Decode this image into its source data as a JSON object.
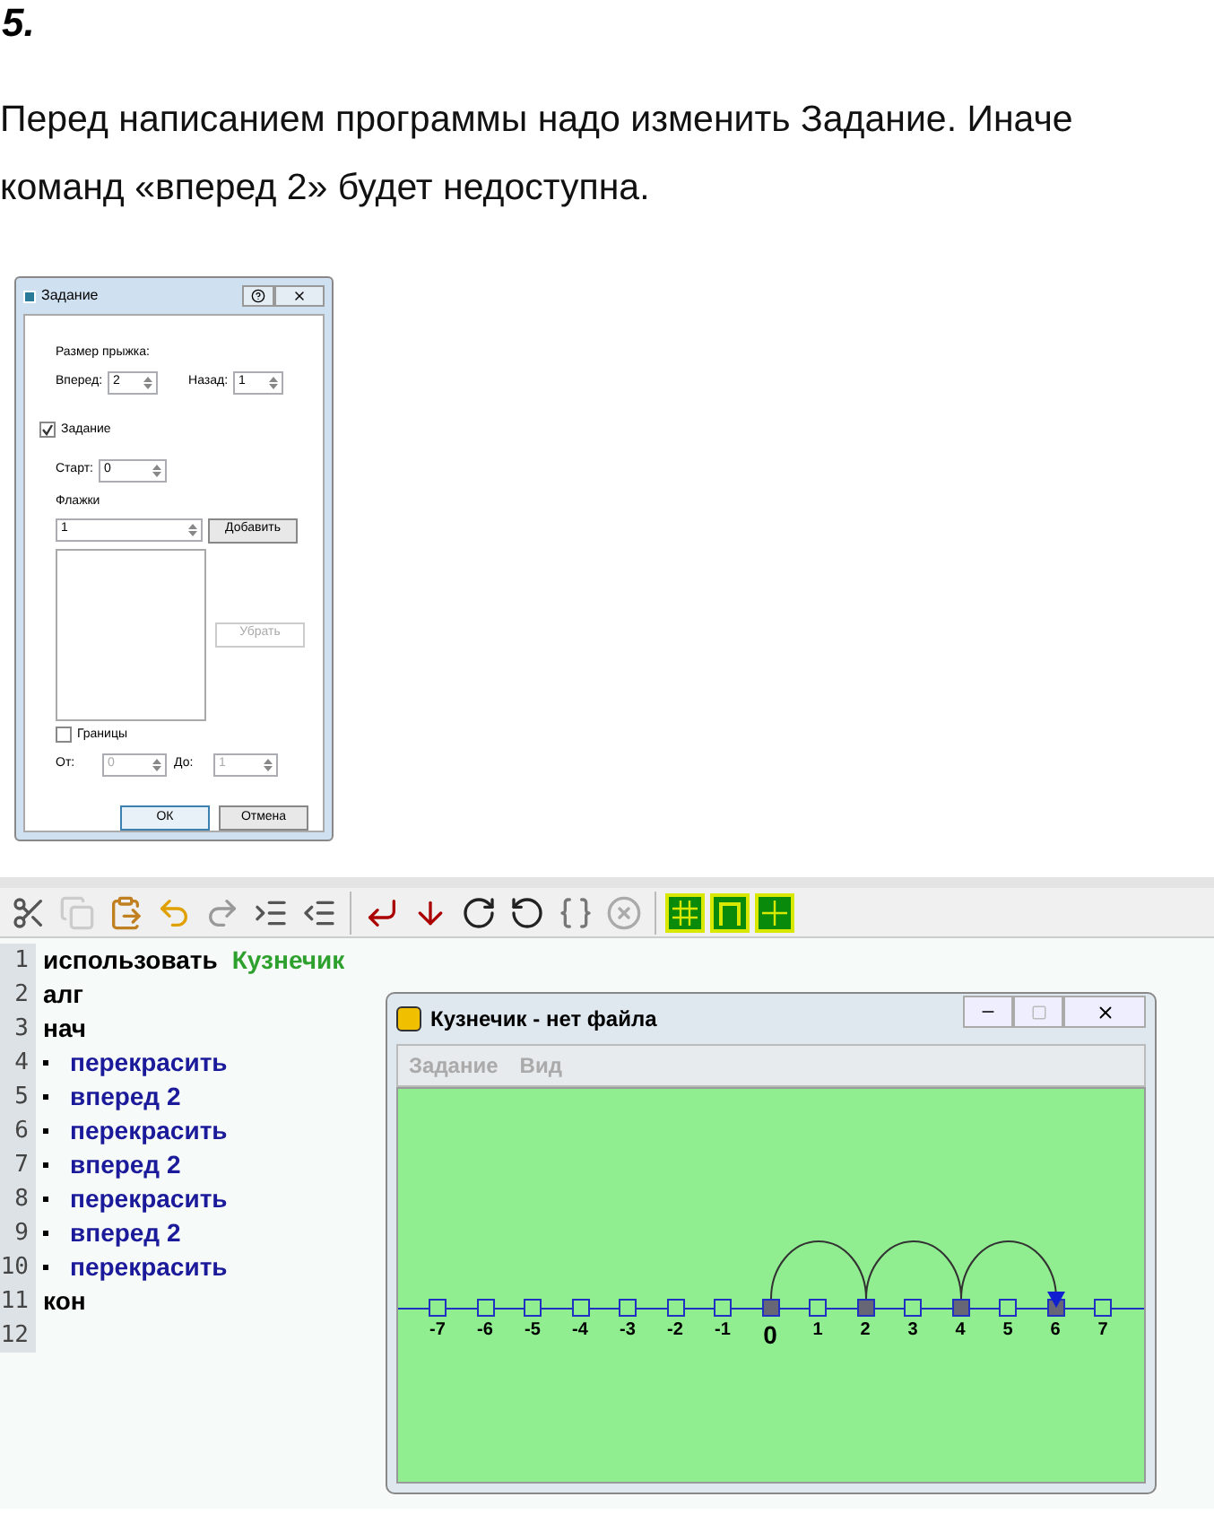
{
  "task_number": "5.",
  "paragraph": "Перед написанием программы надо изменить Задание. Иначе команд «вперед 2» будет недоступна.",
  "dialog": {
    "title": "Задание",
    "section_label": "Размер прыжка:",
    "forward_label": "Вперед:",
    "forward_value": "2",
    "back_label": "Назад:",
    "back_value": "1",
    "task_checkbox": {
      "label": "Задание",
      "checked": true
    },
    "start_label": "Старт:",
    "start_value": "0",
    "flags_label": "Флажки",
    "flag_value": "1",
    "add_button": "Добавить",
    "remove_button": {
      "label": "Убрать",
      "disabled": true
    },
    "bounds_checkbox": {
      "label": "Границы",
      "checked": false
    },
    "from_label": "От:",
    "from_value": "0",
    "to_label": "До:",
    "to_value": "1",
    "ok_button": "ОК",
    "cancel_button": "Отмена"
  },
  "editor": {
    "lines": [
      {
        "number": "1",
        "kind": "use",
        "text": "использовать",
        "module": "Кузнечик"
      },
      {
        "number": "2",
        "kind": "plain",
        "text": "алг"
      },
      {
        "number": "3",
        "kind": "plain",
        "text": "нач"
      },
      {
        "number": "4",
        "kind": "command",
        "text": "перекрасить"
      },
      {
        "number": "5",
        "kind": "command",
        "text": "вперед 2"
      },
      {
        "number": "6",
        "kind": "command",
        "text": "перекрасить"
      },
      {
        "number": "7",
        "kind": "command",
        "text": "вперед 2"
      },
      {
        "number": "8",
        "kind": "command",
        "text": "перекрасить"
      },
      {
        "number": "9",
        "kind": "command",
        "text": "вперед 2"
      },
      {
        "number": "10",
        "kind": "command",
        "text": "перекрасить"
      },
      {
        "number": "11",
        "kind": "plain",
        "text": "кон"
      },
      {
        "number": "12",
        "kind": "empty"
      }
    ]
  },
  "window": {
    "title": "Кузнечик - нет файла",
    "menu": [
      {
        "label": "Задание",
        "disabled": true
      },
      {
        "label": "Вид",
        "disabled": true
      }
    ],
    "cells": [
      {
        "label": "-7",
        "painted": false,
        "current": false,
        "origin": false
      },
      {
        "label": "-6",
        "painted": false,
        "current": false,
        "origin": false
      },
      {
        "label": "-5",
        "painted": false,
        "current": false,
        "origin": false
      },
      {
        "label": "-4",
        "painted": false,
        "current": false,
        "origin": false
      },
      {
        "label": "-3",
        "painted": false,
        "current": false,
        "origin": false
      },
      {
        "label": "-2",
        "painted": false,
        "current": false,
        "origin": false
      },
      {
        "label": "-1",
        "painted": false,
        "current": false,
        "origin": false
      },
      {
        "label": "0",
        "painted": true,
        "current": false,
        "origin": true
      },
      {
        "label": "1",
        "painted": false,
        "current": false,
        "origin": false
      },
      {
        "label": "2",
        "painted": true,
        "current": false,
        "origin": false
      },
      {
        "label": "3",
        "painted": false,
        "current": false,
        "origin": false
      },
      {
        "label": "4",
        "painted": true,
        "current": false,
        "origin": false
      },
      {
        "label": "5",
        "painted": false,
        "current": false,
        "origin": false
      },
      {
        "label": "6",
        "painted": true,
        "current": true,
        "origin": false
      },
      {
        "label": "7",
        "painted": false,
        "current": false,
        "origin": false
      }
    ]
  }
}
